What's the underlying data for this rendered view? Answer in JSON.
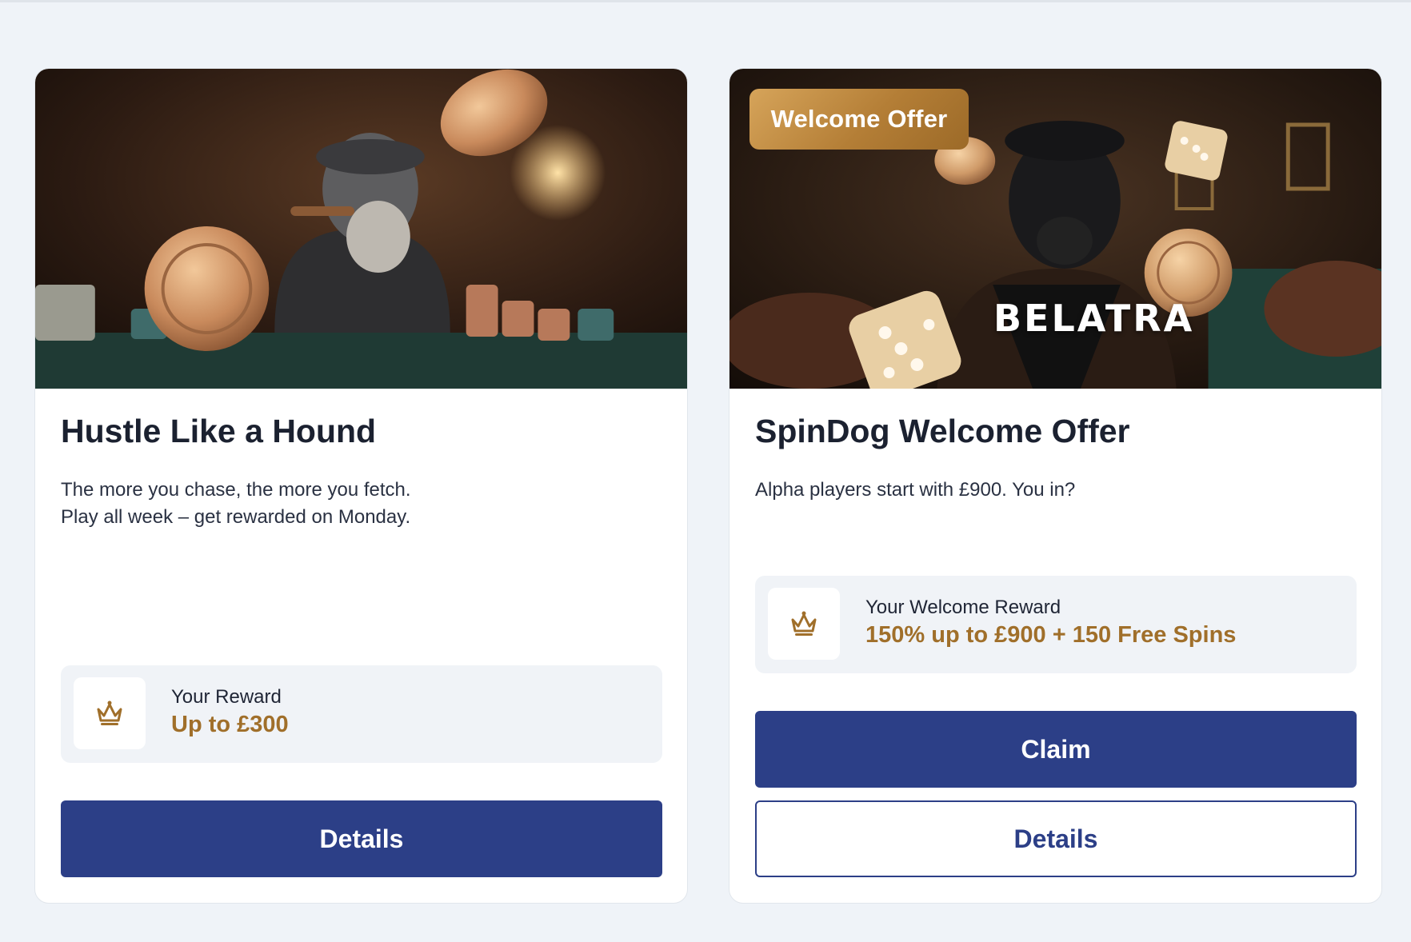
{
  "cards": [
    {
      "title": "Hustle Like a Hound",
      "description_lines": [
        "The more you chase, the more you fetch.",
        "Play all week – get rewarded on Monday."
      ],
      "reward_label": "Your Reward",
      "reward_value": "Up to £300",
      "reward_icon": "crown-icon",
      "details_label": "Details"
    },
    {
      "badge": "Welcome Offer",
      "brand_overlay": "BELATRA",
      "title": "SpinDog Welcome Offer",
      "description_lines": [
        "Alpha players start with £900. You in?"
      ],
      "reward_label": "Your Welcome Reward",
      "reward_value": "150% up to £900 + 150 Free Spins",
      "reward_icon": "crown-icon",
      "claim_label": "Claim",
      "details_label": "Details"
    }
  ],
  "colors": {
    "page_bg": "#eff3f8",
    "primary_button": "#2c3f87",
    "reward_gold": "#a06f2a",
    "badge_gold": "#c08a3e"
  }
}
